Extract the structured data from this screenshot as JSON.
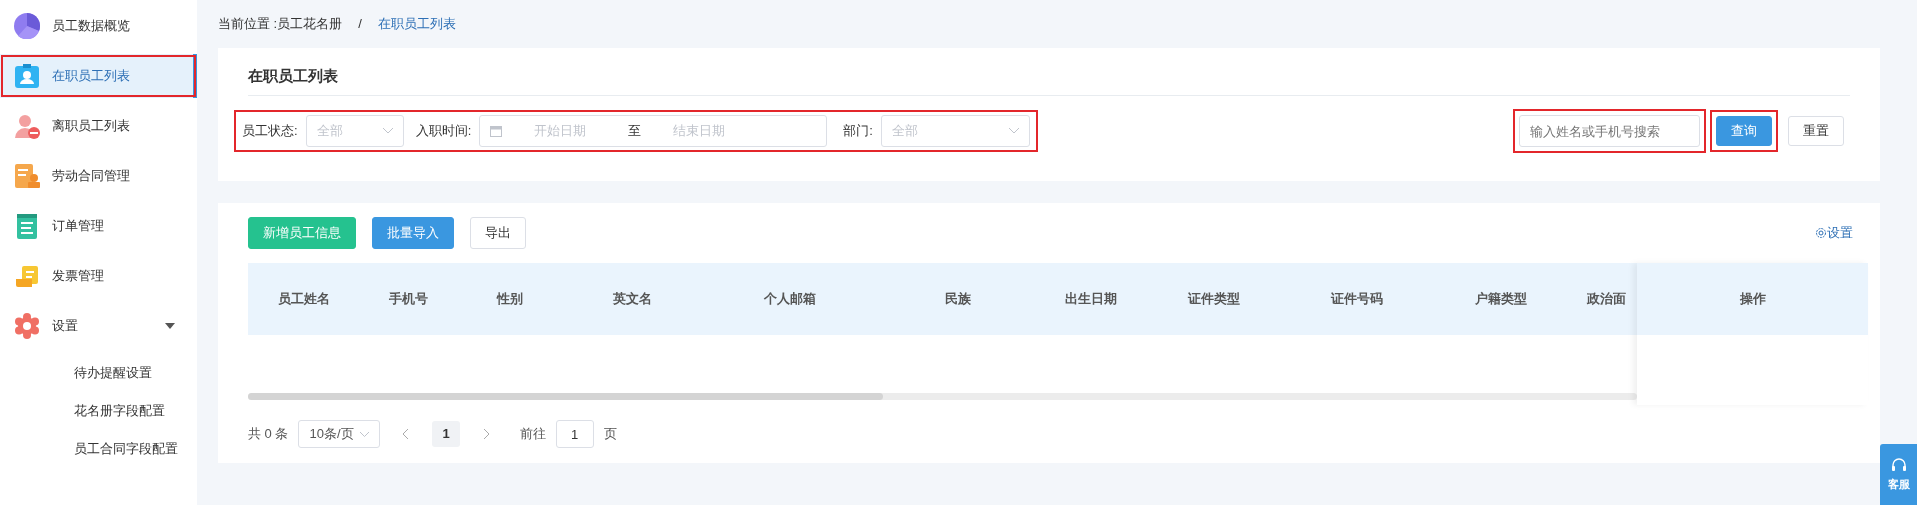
{
  "sidebar": {
    "items": [
      {
        "label": "员工数据概览",
        "selected": false,
        "highlighted": false
      },
      {
        "label": "在职员工列表",
        "selected": true,
        "highlighted": true
      },
      {
        "label": "离职员工列表",
        "selected": false,
        "highlighted": false
      },
      {
        "label": "劳动合同管理",
        "selected": false,
        "highlighted": false
      },
      {
        "label": "订单管理",
        "selected": false,
        "highlighted": false
      },
      {
        "label": "发票管理",
        "selected": false,
        "highlighted": false
      },
      {
        "label": "设置",
        "selected": false,
        "highlighted": false,
        "expanded": true,
        "children": [
          {
            "label": "待办提醒设置",
            "selected": false
          },
          {
            "label": "花名册字段配置",
            "selected": false
          },
          {
            "label": "员工合同字段配置",
            "selected": false
          }
        ]
      }
    ]
  },
  "breadcrumb": {
    "prefix": "当前位置 : ",
    "items": [
      "员工花名册",
      "在职员工列表"
    ],
    "separator": "/"
  },
  "filter_panel": {
    "title": "在职员工列表",
    "filters_highlighted": true,
    "status": {
      "label": "员工状态:",
      "placeholder": "全部"
    },
    "hire_date": {
      "label": "入职时间:",
      "start_placeholder": "开始日期",
      "separator": "至",
      "end_placeholder": "结束日期"
    },
    "department": {
      "label": "部门:",
      "placeholder": "全部"
    },
    "search": {
      "placeholder": "输入姓名或手机号搜索",
      "highlighted": true
    },
    "buttons": [
      {
        "label": "查询",
        "kind": "primary",
        "highlighted": true
      },
      {
        "label": "重置",
        "kind": "default",
        "highlighted": false
      }
    ]
  },
  "toolbar": {
    "buttons": [
      {
        "label": "新增员工信息",
        "kind": "success"
      },
      {
        "label": "批量导入",
        "kind": "primary"
      },
      {
        "label": "导出",
        "kind": "default"
      }
    ],
    "settings_link": "设置"
  },
  "table": {
    "columns": [
      "员工姓名",
      "手机号",
      "性别",
      "英文名",
      "个人邮箱",
      "民族",
      "出生日期",
      "证件类型",
      "证件号码",
      "户籍类型",
      "政治面"
    ],
    "action_column": "操作"
  },
  "pagination": {
    "total": "共 0 条",
    "page_size": "10条/页",
    "pages": [
      {
        "label": "1",
        "selected": true
      }
    ],
    "goto_label": "前往",
    "goto_value": "1",
    "page_suffix": "页"
  },
  "support_widget": {
    "label": "客服"
  }
}
